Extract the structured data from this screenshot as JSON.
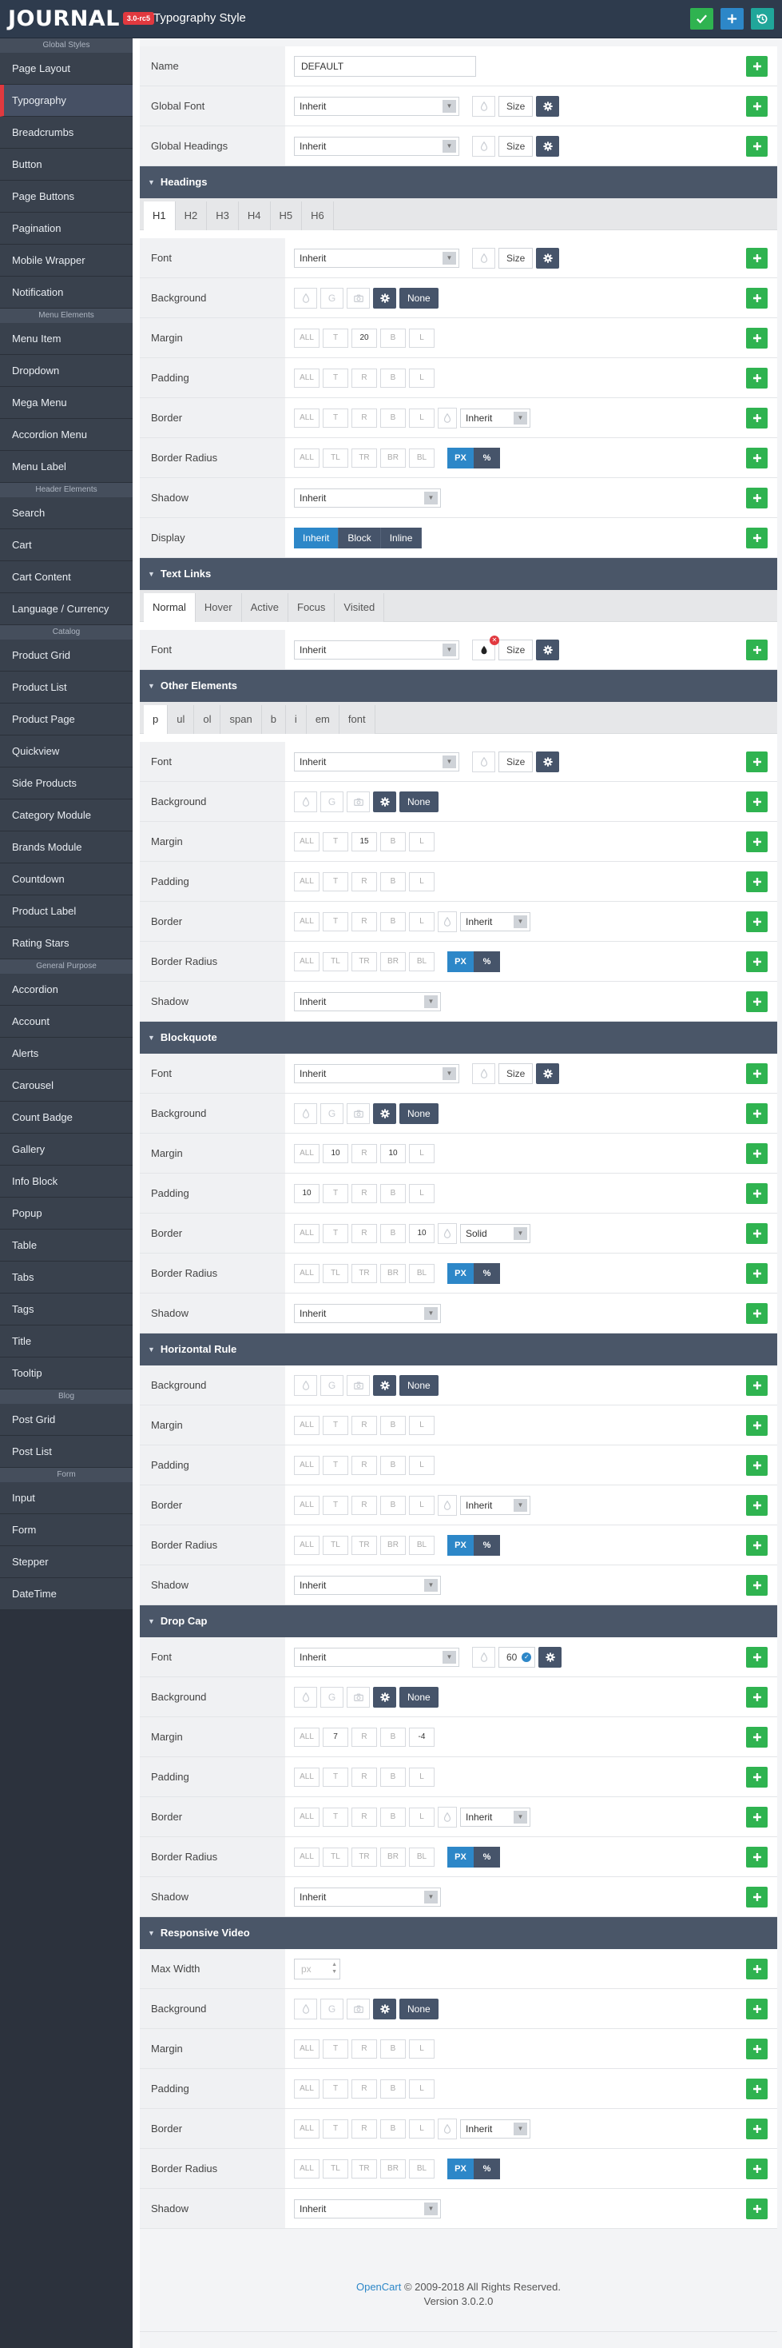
{
  "header": {
    "logo": "JOURNAL",
    "version": "3.0-rc5",
    "title": "Typography Style",
    "accent": "#e1393f",
    "save_color": "#2fb350",
    "add_color": "#2d87c8",
    "reset_color": "#20a69a"
  },
  "sidebar": {
    "groups": [
      {
        "title": "Global Styles",
        "items": [
          "Page Layout",
          "Typography",
          "Breadcrumbs",
          "Button",
          "Page Buttons",
          "Pagination",
          "Mobile Wrapper",
          "Notification"
        ]
      },
      {
        "title": "Menu Elements",
        "items": [
          "Menu Item",
          "Dropdown",
          "Mega Menu",
          "Accordion Menu",
          "Menu Label"
        ]
      },
      {
        "title": "Header Elements",
        "items": [
          "Search",
          "Cart",
          "Cart Content",
          "Language / Currency"
        ]
      },
      {
        "title": "Catalog",
        "items": [
          "Product Grid",
          "Product List",
          "Product Page",
          "Quickview",
          "Side Products",
          "Category Module",
          "Brands Module",
          "Countdown",
          "Product Label",
          "Rating Stars"
        ]
      },
      {
        "title": "General Purpose",
        "items": [
          "Accordion",
          "Account",
          "Alerts",
          "Carousel",
          "Count Badge",
          "Gallery",
          "Info Block",
          "Popup",
          "Table",
          "Tabs",
          "Tags",
          "Title",
          "Tooltip"
        ]
      },
      {
        "title": "Blog",
        "items": [
          "Post Grid",
          "Post List"
        ]
      },
      {
        "title": "Form",
        "items": [
          "Input",
          "Form",
          "Stepper",
          "DateTime"
        ]
      }
    ]
  },
  "labels": {
    "size": "Size",
    "none": "None",
    "inherit": "Inherit",
    "all": "ALL",
    "t": "T",
    "r": "R",
    "b": "B",
    "l": "L",
    "tl": "TL",
    "tr": "TR",
    "br": "BR",
    "bl": "BL",
    "px": "PX",
    "pct": "%",
    "g": "G",
    "solid": "Solid",
    "ph_px": "px"
  },
  "main": {
    "name_label": "Name",
    "name_value": "DEFAULT",
    "global_font_label": "Global Font",
    "global_font_value": "Inherit",
    "global_headings_label": "Global Headings",
    "global_headings_value": "Inherit",
    "headings": {
      "title": "Headings",
      "tabs": [
        "H1",
        "H2",
        "H3",
        "H4",
        "H5",
        "H6"
      ]
    },
    "text_links": {
      "title": "Text Links",
      "tabs": [
        "Normal",
        "Hover",
        "Active",
        "Focus",
        "Visited"
      ]
    },
    "other_elements": {
      "title": "Other Elements",
      "tabs": [
        "p",
        "ul",
        "ol",
        "span",
        "b",
        "i",
        "em",
        "font"
      ]
    },
    "blockquote": {
      "title": "Blockquote"
    },
    "horizontal_rule": {
      "title": "Horizontal Rule"
    },
    "drop_cap": {
      "title": "Drop Cap",
      "size_value": "60"
    },
    "responsive_video": {
      "title": "Responsive Video"
    },
    "row_labels": {
      "font": "Font",
      "background": "Background",
      "margin": "Margin",
      "padding": "Padding",
      "border": "Border",
      "border_radius": "Border Radius",
      "shadow": "Shadow",
      "display": "Display",
      "max_width": "Max Width"
    },
    "display_options": [
      "Inherit",
      "Block",
      "Inline"
    ],
    "values": {
      "h_margin_r": "20",
      "o_margin_r": "15",
      "bq_margin_t": "10",
      "bq_margin_b": "10",
      "bq_padding_all": "10",
      "bq_border_l": "10",
      "dc_margin_t": "7",
      "dc_margin_l": "-4"
    }
  },
  "footer": {
    "brand": "OpenCart",
    "copyright": "© 2009-2018 All Rights Reserved.",
    "version": "Version 3.0.2.0"
  }
}
